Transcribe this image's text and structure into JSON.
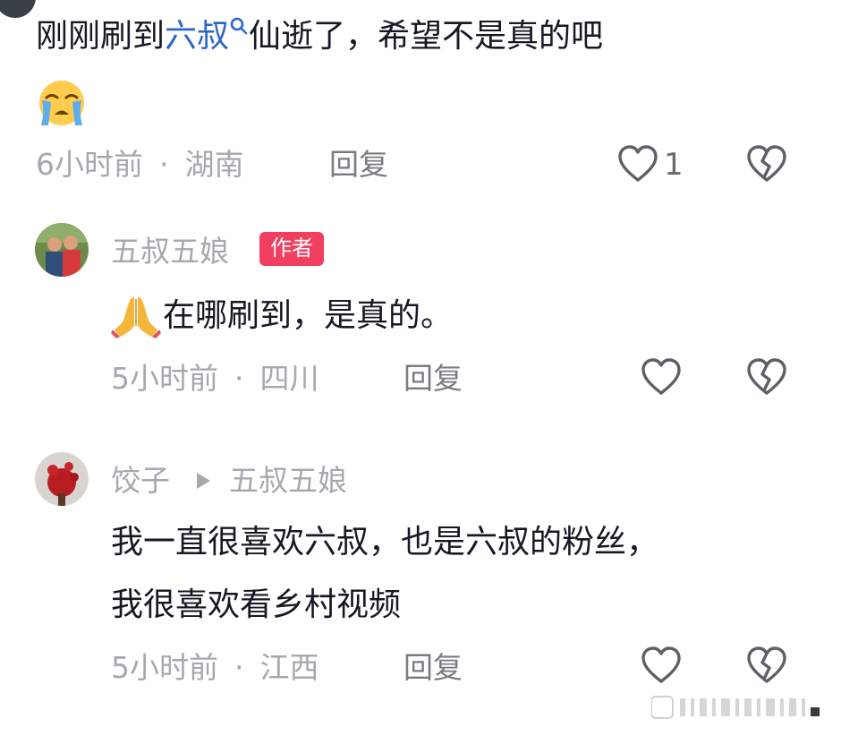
{
  "comments": [
    {
      "text_before": "刚刚刷到",
      "link": "六叔",
      "text_after": "仙逝了，希望不是真的吧",
      "time": "6小时前",
      "separator": "·",
      "location": "湖南",
      "reply_label": "回复",
      "like_count": "1"
    },
    {
      "username": "五叔五娘",
      "badge": "作者",
      "text": "在哪刷到，是真的。",
      "time": "5小时前",
      "separator": "·",
      "location": "四川",
      "reply_label": "回复"
    },
    {
      "username": "饺子",
      "reply_to": "五叔五娘",
      "text_line1": "我一直很喜欢六叔，也是六叔的粉丝，",
      "text_line2": "我很喜欢看乡村视频",
      "time": "5小时前",
      "separator": "·",
      "location": "江西",
      "reply_label": "回复"
    }
  ],
  "colors": {
    "link": "#2a66c8",
    "badge": "#f23e5f",
    "meta": "#a7a8ad"
  }
}
